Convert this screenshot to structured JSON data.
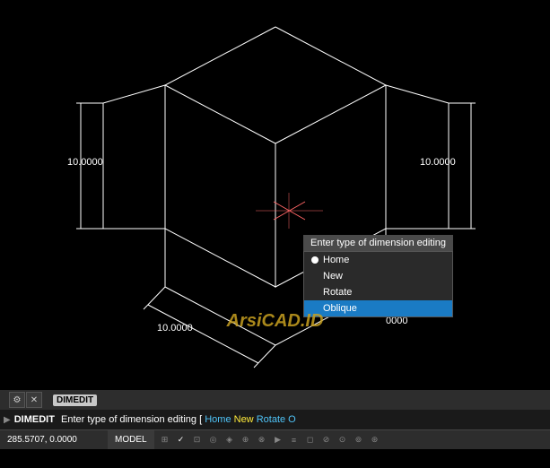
{
  "canvas": {
    "background": "#000000"
  },
  "dimensions": {
    "top_left": "10.0000",
    "top_right": "10.0000",
    "bottom": "10.0000",
    "bottom_right": "0000"
  },
  "tooltip": {
    "header": "Enter type of dimension editing",
    "items": [
      {
        "label": "Home",
        "active": false,
        "bullet": true
      },
      {
        "label": "New",
        "active": false,
        "bullet": false
      },
      {
        "label": "Rotate",
        "active": false,
        "bullet": false
      },
      {
        "label": "Oblique",
        "active": true,
        "bullet": false
      }
    ]
  },
  "command_label": {
    "text": "DIMEDIT"
  },
  "command_line": {
    "prefix": "DIMEDIT",
    "text": "Enter type of dimension editing [",
    "option1": "Home",
    "option2": "New",
    "option3": "Rotate O"
  },
  "status_bar": {
    "coords": "285.5707, 0.0000",
    "model_label": "MODEL",
    "watermark": "ArsiCAD.ID"
  },
  "toolbar": {
    "icons": [
      "⚙",
      "✕",
      "◈",
      "⊞",
      "◻",
      "◼",
      "⊡",
      "⊟",
      "⊕",
      "⊗",
      "⊘",
      "⊙",
      "⊚",
      "⊛",
      "⊜"
    ]
  }
}
